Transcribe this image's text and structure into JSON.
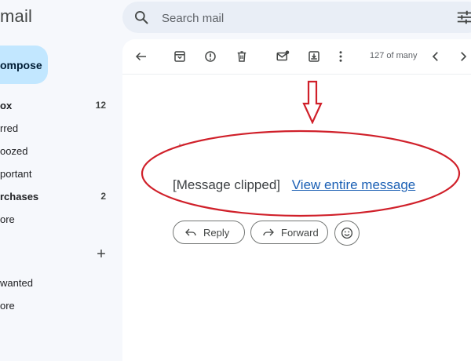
{
  "app": {
    "brand": "mail"
  },
  "compose": {
    "label": "ompose"
  },
  "search": {
    "placeholder": "Search mail",
    "value": ""
  },
  "sidebar": {
    "items": [
      {
        "label": "ox",
        "count": "12",
        "bold": true
      },
      {
        "label": "rred",
        "count": "",
        "bold": false
      },
      {
        "label": "oozed",
        "count": "",
        "bold": false
      },
      {
        "label": "portant",
        "count": "",
        "bold": false
      },
      {
        "label": "rchases",
        "count": "2",
        "bold": true
      },
      {
        "label": "ore",
        "count": "",
        "bold": false
      }
    ],
    "labels_add": "+",
    "labels": [
      {
        "label": "wanted"
      },
      {
        "label": "ore"
      }
    ]
  },
  "toolbar": {
    "icons": [
      "back-arrow-icon",
      "archive-icon",
      "report-spam-icon",
      "delete-icon",
      "mark-unread-icon",
      "move-to-icon",
      "more-vert-icon",
      "chevron-left-icon",
      "chevron-right-icon"
    ],
    "pager": "127 of many"
  },
  "message": {
    "ellipsis": "··",
    "clipped_text": "[Message clipped]",
    "view_link": "View entire message"
  },
  "actions": {
    "reply": "Reply",
    "forward": "Forward"
  },
  "annotation": {
    "color": "#d0202a"
  },
  "colors": {
    "compose_bg": "#c2e7ff",
    "link": "#1a5fb4",
    "page_bg": "#f6f8fc"
  }
}
